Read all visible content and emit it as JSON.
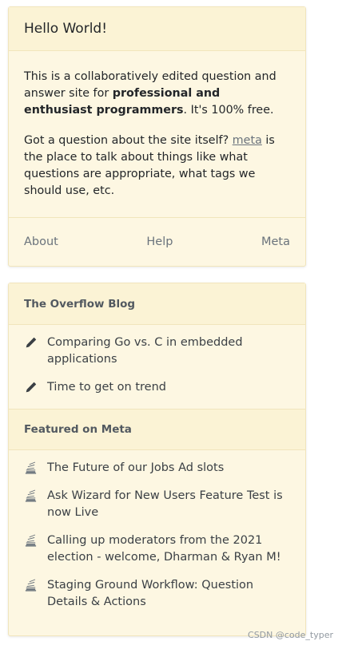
{
  "hello": {
    "title": "Hello World!",
    "intro_prefix": "This is a collaboratively edited question and answer site for ",
    "intro_bold": "professional and enthusiast programmers",
    "intro_suffix": ". It's 100% free.",
    "meta_prefix": "Got a question about the site itself? ",
    "meta_link": "meta",
    "meta_suffix": " is the place to talk about things like what questions are appropriate, what tags we should use, etc.",
    "footer": {
      "about": "About",
      "help": "Help",
      "meta": "Meta"
    }
  },
  "sidebar": {
    "blog_header": "The Overflow Blog",
    "blog_items": [
      {
        "label": "Comparing Go vs. C in embedded applications",
        "icon": "pencil-icon"
      },
      {
        "label": "Time to get on trend",
        "icon": "pencil-icon"
      }
    ],
    "meta_header": "Featured on Meta",
    "meta_items": [
      {
        "label": "The Future of our Jobs Ad slots",
        "icon": "stack-exchange-icon"
      },
      {
        "label": "Ask Wizard for New Users Feature Test is now Live",
        "icon": "stack-exchange-icon"
      },
      {
        "label": "Calling up moderators from the 2021 election - welcome, Dharman & Ryan M!",
        "icon": "stack-exchange-icon"
      },
      {
        "label": "Staging Ground Workflow: Question Details & Actions",
        "icon": "stack-exchange-icon"
      }
    ]
  },
  "watermark": "CSDN @code_typer",
  "colors": {
    "card_bg": "#fdf7e2",
    "header_bg": "#fbf3d5",
    "border": "#f1e5bc",
    "muted": "#6a737c"
  }
}
